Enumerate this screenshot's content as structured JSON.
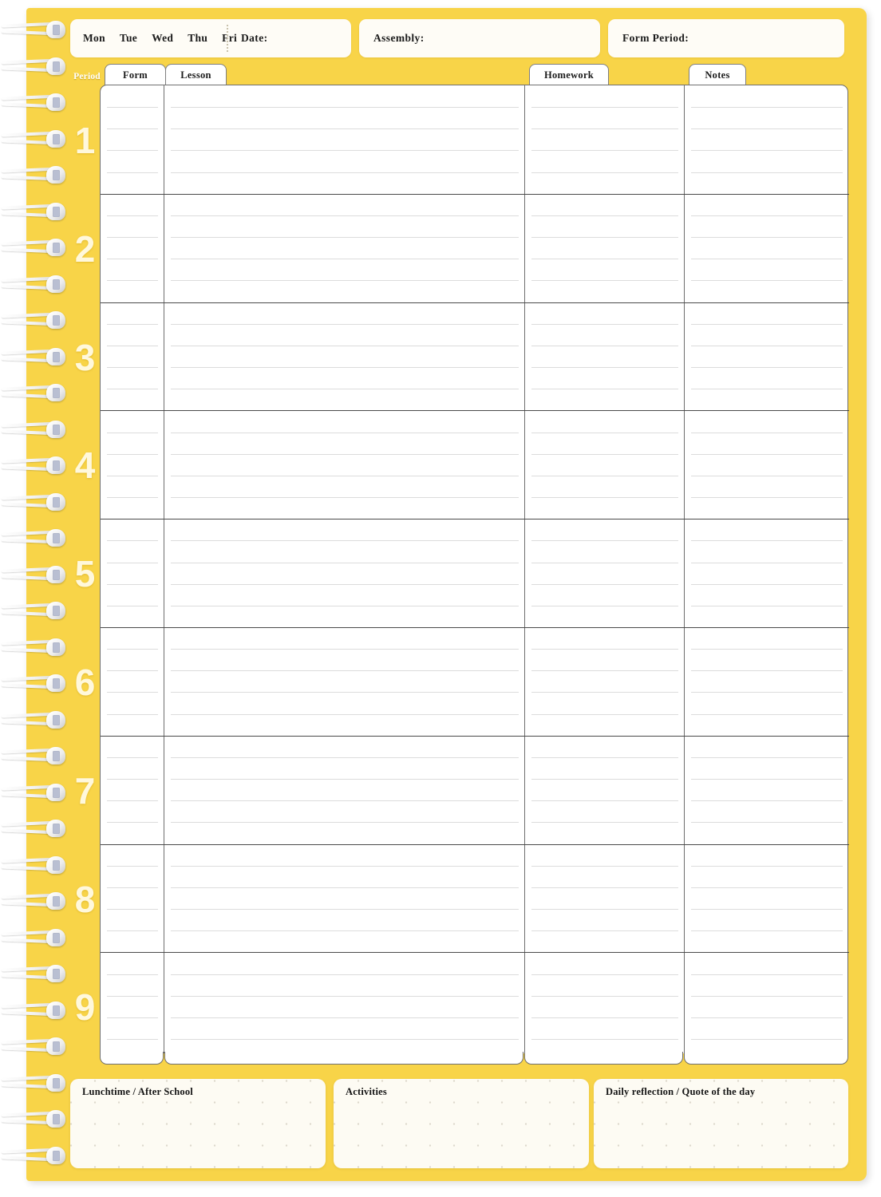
{
  "page": {
    "title": "Teacher Daily Planner Page",
    "accent_color": "#F8D448",
    "paper_color": "#F8D448",
    "field_color": "#FEFCF6",
    "grid_color": "#FFFFFF",
    "rule_color": "#DCDCDC",
    "separator_color": "#4A4A4A",
    "number_color": "#FFF8DC"
  },
  "header": {
    "days": [
      {
        "label": "Mon"
      },
      {
        "label": "Tue"
      },
      {
        "label": "Wed"
      },
      {
        "label": "Thu"
      },
      {
        "label": "Fri"
      }
    ],
    "date_label": "Date:",
    "date_value": "",
    "assembly_label": "Assembly:",
    "assembly_value": "",
    "form_period_label": "Form Period:",
    "form_period_value": ""
  },
  "grid": {
    "period_column_label": "Period",
    "tabs": [
      {
        "label": "Form"
      },
      {
        "label": "Lesson"
      },
      {
        "label": "Homework"
      },
      {
        "label": "Notes"
      }
    ],
    "periods": [
      {
        "number": "1"
      },
      {
        "number": "2"
      },
      {
        "number": "3"
      },
      {
        "number": "4"
      },
      {
        "number": "5"
      },
      {
        "number": "6"
      },
      {
        "number": "7"
      },
      {
        "number": "8"
      },
      {
        "number": "9"
      }
    ]
  },
  "footer": {
    "boxes": [
      {
        "title": "Lunchtime / After School",
        "value": ""
      },
      {
        "title": "Activities",
        "value": ""
      },
      {
        "title": "Daily reflection / Quote of the day",
        "value": ""
      }
    ]
  },
  "binding": {
    "type": "spiral-wire-binding",
    "coil_count": 32
  }
}
